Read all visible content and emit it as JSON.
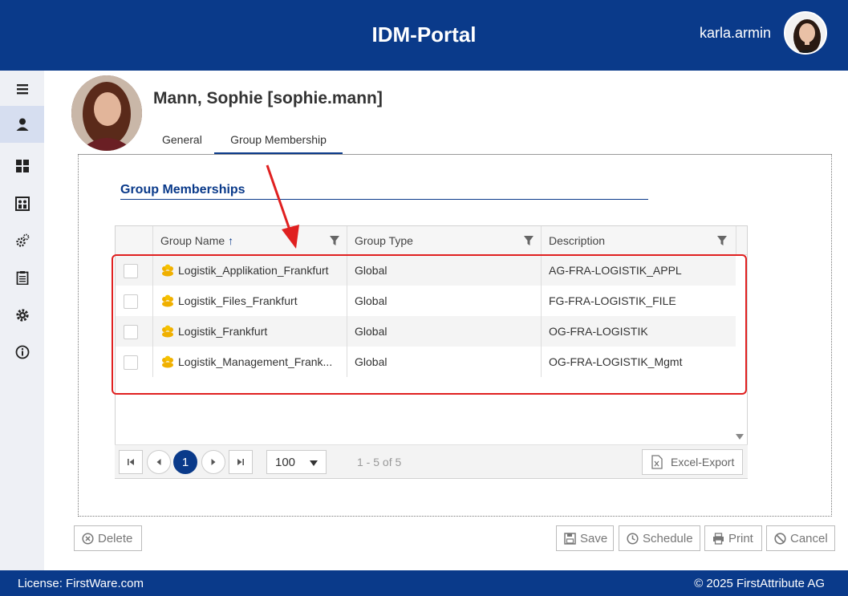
{
  "header": {
    "title": "IDM-Portal",
    "username": "karla.armin"
  },
  "sidebar": {
    "items": [
      {
        "icon": "menu-icon"
      },
      {
        "icon": "user-icon",
        "active": true
      },
      {
        "icon": "dashboard-icon"
      },
      {
        "icon": "groups-icon"
      },
      {
        "icon": "gears-icon"
      },
      {
        "icon": "clipboard-icon"
      },
      {
        "icon": "settings-icon"
      },
      {
        "icon": "info-icon"
      }
    ]
  },
  "profile": {
    "name": "Mann, Sophie [sophie.mann]"
  },
  "tabs": [
    {
      "label": "General",
      "active": false
    },
    {
      "label": "Group Membership",
      "active": true
    }
  ],
  "section": {
    "title": "Group Memberships"
  },
  "grid": {
    "columns": [
      "Group Name",
      "Group Type",
      "Description"
    ],
    "sort": {
      "column": "Group Name",
      "direction": "ascending"
    },
    "rows": [
      {
        "name": "Logistik_Applikation_Frankfurt",
        "type": "Global",
        "description": "AG-FRA-LOGISTIK_APPL"
      },
      {
        "name": "Logistik_Files_Frankfurt",
        "type": "Global",
        "description": "FG-FRA-LOGISTIK_FILE"
      },
      {
        "name": "Logistik_Frankfurt",
        "type": "Global",
        "description": "OG-FRA-LOGISTIK"
      },
      {
        "name": "Logistik_Management_Frank...",
        "type": "Global",
        "description": "OG-FRA-LOGISTIK_Mgmt"
      }
    ]
  },
  "pager": {
    "current_page": "1",
    "page_size": "100",
    "info": "1 - 5 of 5",
    "export_label": "Excel-Export"
  },
  "actions": {
    "delete": "Delete",
    "save": "Save",
    "schedule": "Schedule",
    "print": "Print",
    "cancel": "Cancel"
  },
  "footer": {
    "license": "License: FirstWare.com",
    "copyright": "© 2025 FirstAttribute AG"
  },
  "colors": {
    "brand": "#0a3a8a",
    "highlight": "#e02020",
    "group_icon": "#f0b000"
  }
}
